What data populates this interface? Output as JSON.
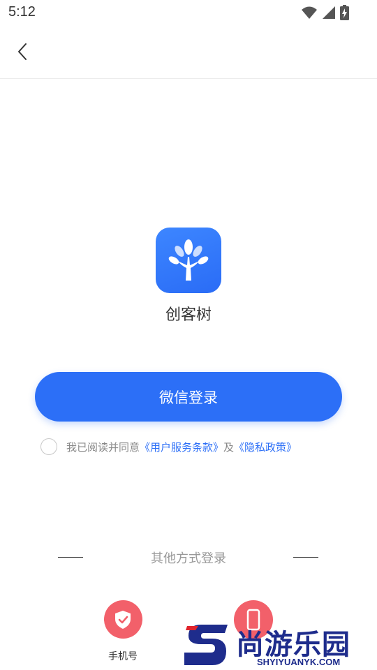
{
  "status_bar": {
    "time": "5:12",
    "icons": [
      "wifi-icon",
      "cellular-signal-icon",
      "battery-charging-icon"
    ]
  },
  "header": {
    "back_icon": "chevron-left-icon"
  },
  "app": {
    "logo_icon": "tree-icon",
    "name": "创客树"
  },
  "login": {
    "wechat_button_label": "微信登录"
  },
  "agreement": {
    "checked": false,
    "prefix": "我已阅读并同意",
    "terms_link": "《用户服务条款》",
    "connector": "及",
    "privacy_link": "《隐私政策》"
  },
  "other_login": {
    "label": "其他方式登录",
    "methods": [
      {
        "label": "手机号",
        "icon": "shield-check-icon"
      },
      {
        "label": "",
        "icon": "phone-device-icon"
      }
    ]
  },
  "watermark": {
    "text": "尚游乐园",
    "sub": "SHYIYUANYK.COM"
  },
  "colors": {
    "primary": "#2c6ff7",
    "accent_red": "#f2606a",
    "text": "#333333",
    "muted": "#888888"
  }
}
